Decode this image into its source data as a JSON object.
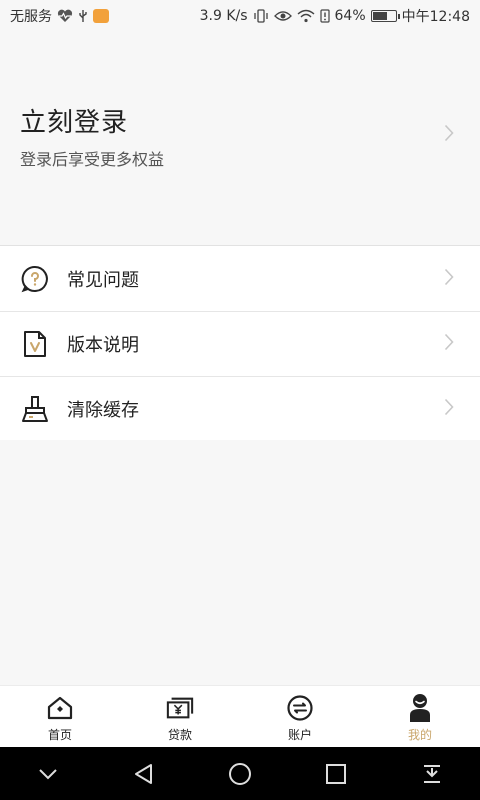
{
  "status_bar": {
    "carrier": "无服务",
    "speed": "3.9 K/s",
    "battery": "64%",
    "battery_level": 0.64,
    "time": "中午12:48"
  },
  "login": {
    "title": "立刻登录",
    "subtitle": "登录后享受更多权益"
  },
  "menu": [
    {
      "label": "常见问题",
      "icon": "question-bubble-icon"
    },
    {
      "label": "版本说明",
      "icon": "version-doc-icon"
    },
    {
      "label": "清除缓存",
      "icon": "broom-icon"
    }
  ],
  "tabs": [
    {
      "label": "首页",
      "icon": "home-icon"
    },
    {
      "label": "贷款",
      "icon": "loan-icon"
    },
    {
      "label": "账户",
      "icon": "account-icon"
    },
    {
      "label": "我的",
      "icon": "profile-icon",
      "active": true
    }
  ],
  "colors": {
    "accent": "#c9a66b",
    "background": "#f7f7f7",
    "text": "#222222"
  }
}
